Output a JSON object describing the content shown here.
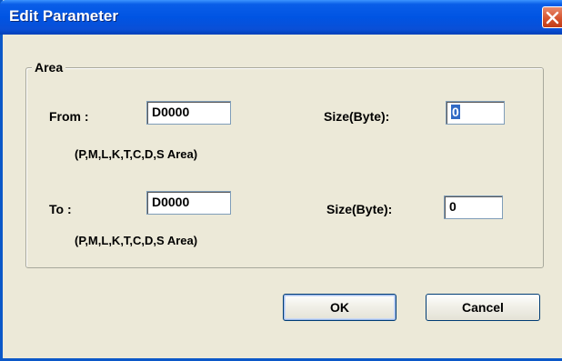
{
  "window": {
    "title": "Edit Parameter"
  },
  "area": {
    "legend": "Area",
    "from": {
      "label": "From :",
      "value": "D0000",
      "hint": "(P,M,L,K,T,C,D,S Area)",
      "size_label": "Size(Byte):",
      "size_value": "0"
    },
    "to": {
      "label": "To :",
      "value": "D0000",
      "hint": "(P,M,L,K,T,C,D,S Area)",
      "size_label": "Size(Byte):",
      "size_value": "0"
    }
  },
  "buttons": {
    "ok": "OK",
    "cancel": "Cancel"
  },
  "colors": {
    "titlebar": "#0054e3",
    "close": "#d4502a",
    "dialog_bg": "#ece9d8",
    "selection": "#316ac5"
  },
  "icons": {
    "close": "close-icon"
  }
}
